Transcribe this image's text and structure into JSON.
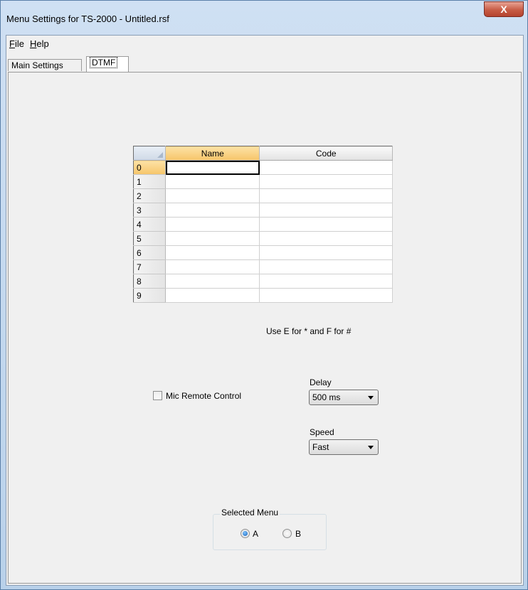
{
  "window": {
    "title": "Menu Settings for TS-2000 - Untitled.rsf",
    "close_glyph": "X"
  },
  "menubar": {
    "items": [
      {
        "label": "File",
        "mnemonic": "F",
        "rest": "ile"
      },
      {
        "label": "Help",
        "mnemonic": "H",
        "rest": "elp"
      }
    ]
  },
  "tabs": [
    {
      "label": "Main Settings",
      "active": false
    },
    {
      "label": "DTMF",
      "active": true
    }
  ],
  "dtmf_table": {
    "columns": [
      "Name",
      "Code"
    ],
    "rows": [
      {
        "index": "0",
        "name": "",
        "code": ""
      },
      {
        "index": "1",
        "name": "",
        "code": ""
      },
      {
        "index": "2",
        "name": "",
        "code": ""
      },
      {
        "index": "3",
        "name": "",
        "code": ""
      },
      {
        "index": "4",
        "name": "",
        "code": ""
      },
      {
        "index": "5",
        "name": "",
        "code": ""
      },
      {
        "index": "6",
        "name": "",
        "code": ""
      },
      {
        "index": "7",
        "name": "",
        "code": ""
      },
      {
        "index": "8",
        "name": "",
        "code": ""
      },
      {
        "index": "9",
        "name": "",
        "code": ""
      }
    ]
  },
  "hint": "Use E for * and F for #",
  "mic_remote_control": {
    "label": "Mic Remote Control",
    "checked": false
  },
  "delay": {
    "label": "Delay",
    "value": "500 ms"
  },
  "speed": {
    "label": "Speed",
    "value": "Fast"
  },
  "selected_menu": {
    "title": "Selected Menu",
    "options": [
      {
        "label": "A",
        "checked": true
      },
      {
        "label": "B",
        "checked": false
      }
    ]
  }
}
